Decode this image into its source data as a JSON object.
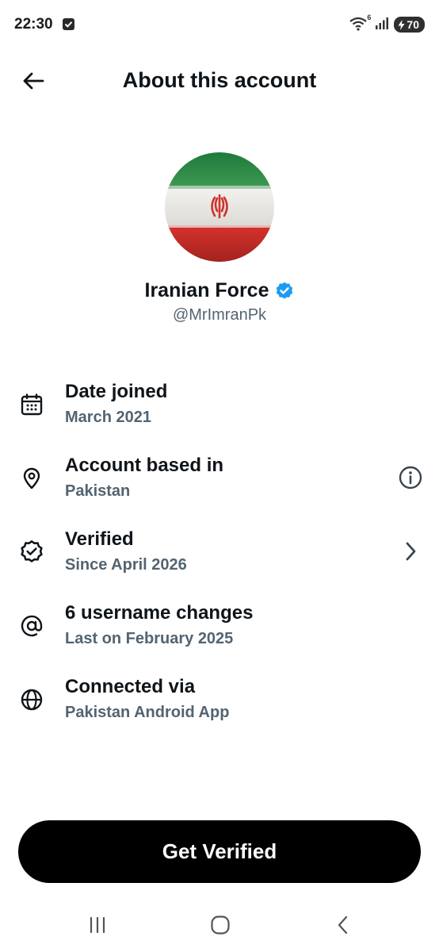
{
  "status_bar": {
    "time": "22:30",
    "battery": "70",
    "wifi_badge": "6",
    "icons": [
      "notification-check-icon",
      "wifi-icon",
      "signal-icon",
      "battery-charging-icon"
    ]
  },
  "header": {
    "title": "About this account",
    "back_icon": "arrow-left-icon"
  },
  "profile": {
    "display_name": "Iranian Force",
    "handle": "@MrImranPk",
    "verified_badge_color": "#1d9bf0",
    "avatar": "iran-flag-image"
  },
  "info_items": [
    {
      "icon": "calendar-icon",
      "title": "Date joined",
      "subtitle": "March 2021"
    },
    {
      "icon": "location-pin-icon",
      "title": "Account based in",
      "subtitle": "Pakistan",
      "action_icon": "info-circle-icon"
    },
    {
      "icon": "verified-badge-icon",
      "title": "Verified",
      "subtitle": "Since April 2026",
      "action_icon": "chevron-right-icon"
    },
    {
      "icon": "at-sign-icon",
      "title": "6 username changes",
      "subtitle": "Last on February 2025"
    },
    {
      "icon": "globe-icon",
      "title": "Connected via",
      "subtitle": "Pakistan Android App"
    }
  ],
  "cta": {
    "label": "Get Verified"
  },
  "nav_bar": {
    "icons": [
      "recent-apps-icon",
      "home-icon",
      "back-icon"
    ]
  },
  "colors": {
    "primary_text": "#0f1419",
    "secondary_text": "#536471",
    "accent": "#1d9bf0",
    "button_bg": "#000000"
  }
}
